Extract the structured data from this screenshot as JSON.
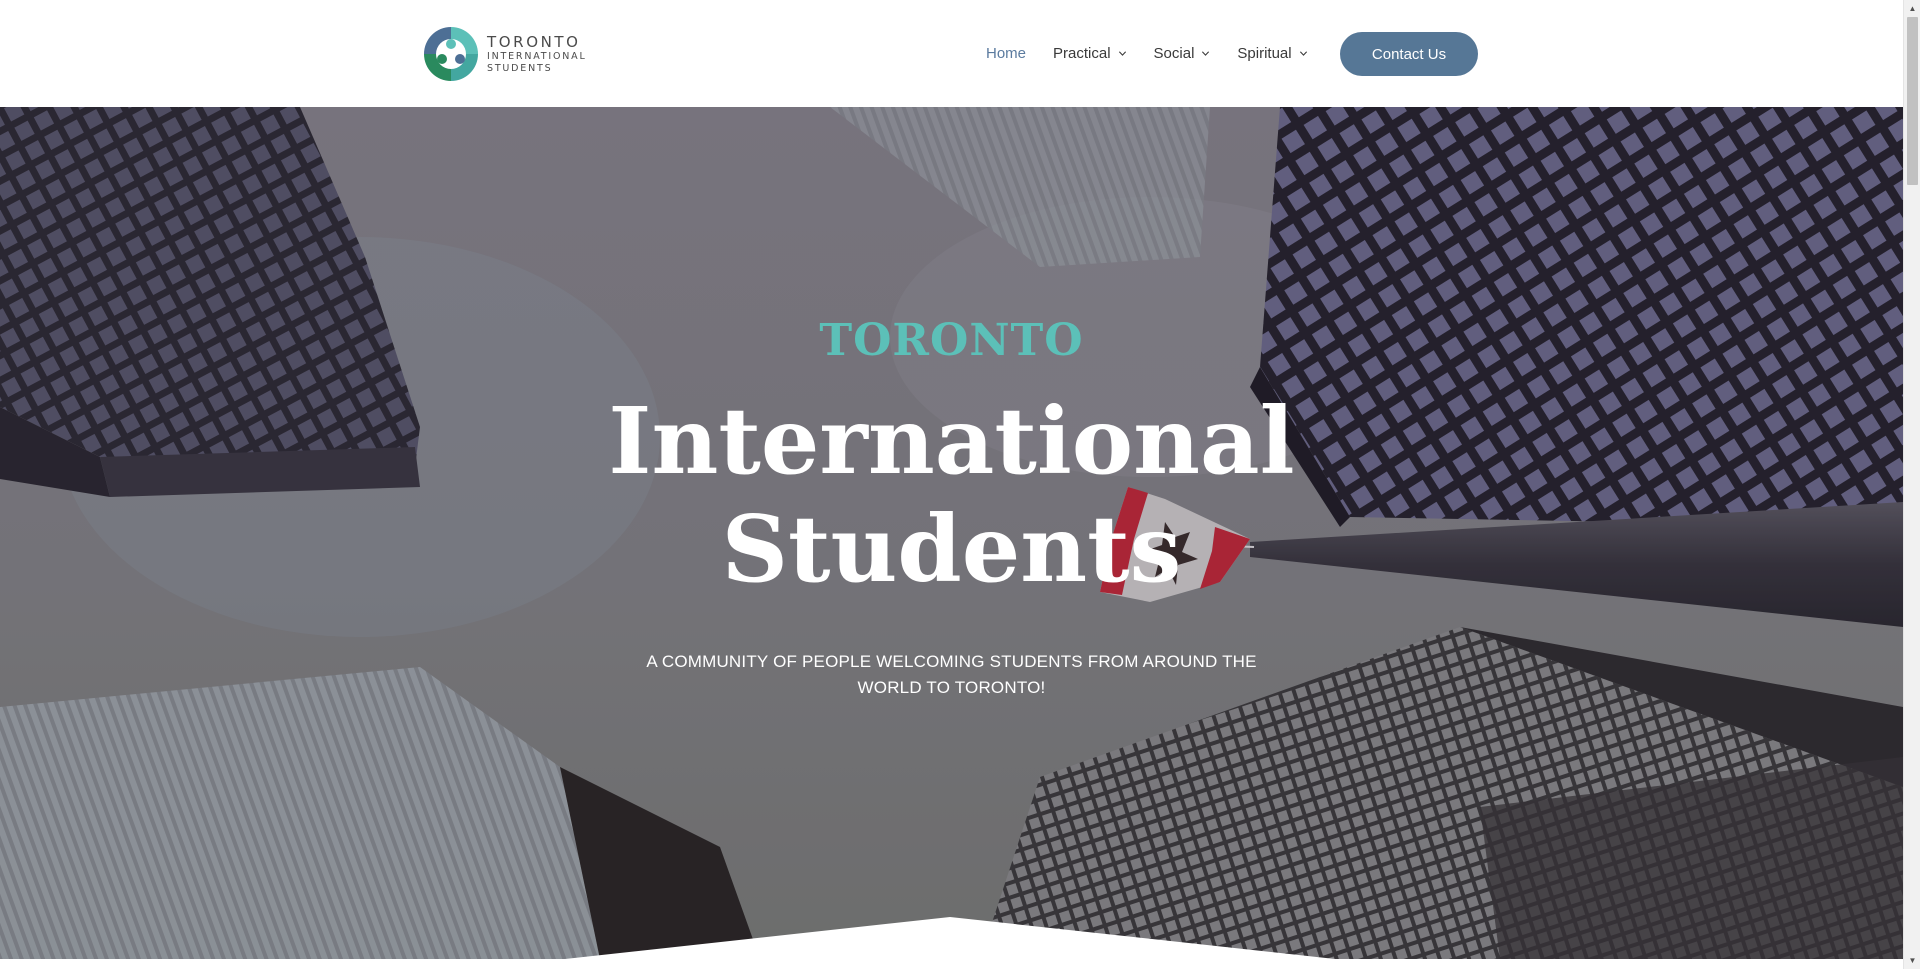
{
  "header": {
    "logo": {
      "line1": "TORONTO",
      "line2": "INTERNATIONAL",
      "line3": "STUDENTS"
    },
    "nav": [
      {
        "label": "Home",
        "active": true,
        "has_dropdown": false
      },
      {
        "label": "Practical",
        "active": false,
        "has_dropdown": true
      },
      {
        "label": "Social",
        "active": false,
        "has_dropdown": true
      },
      {
        "label": "Spiritual",
        "active": false,
        "has_dropdown": true
      }
    ],
    "contact_label": "Contact Us"
  },
  "hero": {
    "eyebrow": "TORONTO",
    "headline_line1": "International",
    "headline_line2": "Students",
    "tagline": "A COMMUNITY OF PEOPLE WELCOMING STUDENTS FROM AROUND THE WORLD TO TORONTO!"
  },
  "colors": {
    "accent": "#5cc0b8",
    "nav_active": "#5b7b9f",
    "button": "#567796",
    "text": "#3a3a3a"
  }
}
